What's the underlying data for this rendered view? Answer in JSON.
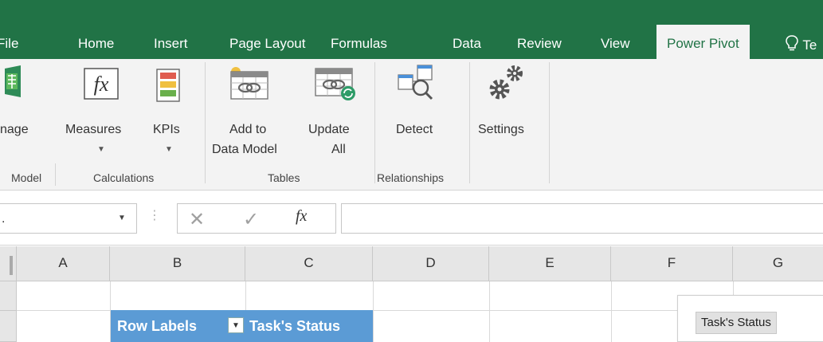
{
  "tabs": [
    {
      "label": "File"
    },
    {
      "label": "Home"
    },
    {
      "label": "Insert"
    },
    {
      "label": "Page Layout"
    },
    {
      "label": "Formulas"
    },
    {
      "label": "Data"
    },
    {
      "label": "Review"
    },
    {
      "label": "View"
    },
    {
      "label": "Power Pivot"
    },
    {
      "label": "Te"
    }
  ],
  "ribbon": {
    "manage": {
      "label": "nage"
    },
    "measures": {
      "label": "Measures",
      "icon": "fx-icon"
    },
    "kpis": {
      "label": "KPIs"
    },
    "add_to_data_model": {
      "label1": "Add to",
      "label2": "Data Model"
    },
    "update_all": {
      "label1": "Update",
      "label2": "All"
    },
    "detect": {
      "label": "Detect"
    },
    "settings": {
      "label": "Settings"
    },
    "groups": {
      "model": "Model",
      "calculations": "Calculations",
      "tables": "Tables",
      "relationships": "Relationships"
    }
  },
  "formula_bar": {
    "namebox_value": ".",
    "cancel": "✕",
    "enter": "✓",
    "fx": "fx",
    "value": ""
  },
  "grid": {
    "columns": [
      "A",
      "B",
      "C",
      "D",
      "E",
      "F",
      "G"
    ]
  },
  "pivot": {
    "row_labels": "Row Labels",
    "task_status": "Task's Status"
  },
  "slicer": {
    "title": "Task's Status"
  },
  "colors": {
    "accent": "#217346",
    "pivot_header": "#5b9bd5"
  }
}
